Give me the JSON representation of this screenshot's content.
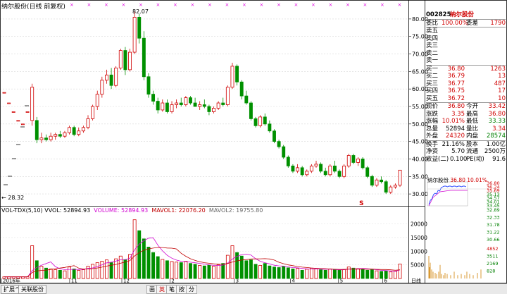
{
  "main_chart": {
    "title": "纳尔股份(日线 前复权)",
    "price_ticks": [
      "80.00",
      "75.00",
      "70.00",
      "65.00",
      "60.00",
      "55.00",
      "50.00",
      "45.00",
      "40.00",
      "35.00",
      "30.00"
    ],
    "high_label": "82.07",
    "low_label": "28.32",
    "signal_marker": "S",
    "candles": [
      {
        "o": 59.0,
        "h": 59.0,
        "l": 59.0,
        "c": 59.0
      },
      {
        "o": 56.0,
        "h": 56.0,
        "l": 56.0,
        "c": 56.0
      },
      {
        "o": 53.5,
        "h": 53.5,
        "l": 53.5,
        "c": 53.5
      },
      {
        "o": 51.0,
        "h": 51.0,
        "l": 51.0,
        "c": 51.0
      },
      {
        "o": 50.0,
        "h": 50.0,
        "l": 50.0,
        "c": 50.0
      },
      {
        "o": 53.5,
        "h": 53.5,
        "l": 53.5,
        "c": 53.5
      },
      {
        "o": 51.0,
        "h": 61.5,
        "l": 49.5,
        "c": 60.5
      },
      {
        "o": 51.0,
        "h": 52.0,
        "l": 44.5,
        "c": 45.5
      },
      {
        "o": 45.5,
        "h": 47.5,
        "l": 44.5,
        "c": 46.0
      },
      {
        "o": 46.0,
        "h": 47.0,
        "l": 45.0,
        "c": 45.5
      },
      {
        "o": 45.5,
        "h": 47.5,
        "l": 45.0,
        "c": 46.5
      },
      {
        "o": 46.5,
        "h": 47.5,
        "l": 45.5,
        "c": 47.0
      },
      {
        "o": 47.0,
        "h": 48.0,
        "l": 46.0,
        "c": 46.5
      },
      {
        "o": 46.5,
        "h": 48.0,
        "l": 46.0,
        "c": 47.5
      },
      {
        "o": 47.5,
        "h": 49.5,
        "l": 47.0,
        "c": 49.0
      },
      {
        "o": 49.0,
        "h": 49.5,
        "l": 46.5,
        "c": 47.0
      },
      {
        "o": 47.0,
        "h": 49.0,
        "l": 46.5,
        "c": 48.0
      },
      {
        "o": 48.0,
        "h": 49.5,
        "l": 47.5,
        "c": 49.0
      },
      {
        "o": 49.0,
        "h": 52.5,
        "l": 48.5,
        "c": 51.5
      },
      {
        "o": 51.5,
        "h": 55.5,
        "l": 51.0,
        "c": 55.0
      },
      {
        "o": 55.0,
        "h": 59.5,
        "l": 54.0,
        "c": 58.5
      },
      {
        "o": 58.5,
        "h": 63.5,
        "l": 57.5,
        "c": 62.5
      },
      {
        "o": 62.5,
        "h": 65.5,
        "l": 61.5,
        "c": 64.0
      },
      {
        "o": 64.0,
        "h": 66.0,
        "l": 60.0,
        "c": 61.0
      },
      {
        "o": 61.0,
        "h": 66.5,
        "l": 60.5,
        "c": 66.0
      },
      {
        "o": 66.0,
        "h": 71.5,
        "l": 65.5,
        "c": 71.0
      },
      {
        "o": 71.0,
        "h": 72.0,
        "l": 64.0,
        "c": 65.5
      },
      {
        "o": 65.5,
        "h": 71.5,
        "l": 65.0,
        "c": 70.5
      },
      {
        "o": 70.5,
        "h": 82.07,
        "l": 70.0,
        "c": 80.5
      },
      {
        "o": 80.5,
        "h": 81.5,
        "l": 73.0,
        "c": 74.5
      },
      {
        "o": 74.5,
        "h": 76.5,
        "l": 62.5,
        "c": 63.5
      },
      {
        "o": 63.5,
        "h": 64.5,
        "l": 57.5,
        "c": 58.5
      },
      {
        "o": 58.5,
        "h": 59.5,
        "l": 55.5,
        "c": 56.5
      },
      {
        "o": 56.5,
        "h": 57.5,
        "l": 53.0,
        "c": 54.0
      },
      {
        "o": 54.0,
        "h": 57.0,
        "l": 53.5,
        "c": 56.0
      },
      {
        "o": 56.0,
        "h": 57.0,
        "l": 53.0,
        "c": 53.5
      },
      {
        "o": 53.5,
        "h": 56.5,
        "l": 53.0,
        "c": 55.5
      },
      {
        "o": 55.5,
        "h": 57.0,
        "l": 54.5,
        "c": 56.0
      },
      {
        "o": 56.0,
        "h": 57.5,
        "l": 55.0,
        "c": 55.5
      },
      {
        "o": 55.5,
        "h": 58.0,
        "l": 55.0,
        "c": 57.5
      },
      {
        "o": 57.5,
        "h": 58.0,
        "l": 55.5,
        "c": 56.0
      },
      {
        "o": 56.0,
        "h": 57.5,
        "l": 55.0,
        "c": 55.0
      },
      {
        "o": 55.0,
        "h": 56.5,
        "l": 54.0,
        "c": 55.5
      },
      {
        "o": 55.5,
        "h": 57.0,
        "l": 54.5,
        "c": 55.0
      },
      {
        "o": 55.0,
        "h": 55.5,
        "l": 52.5,
        "c": 53.5
      },
      {
        "o": 53.5,
        "h": 55.0,
        "l": 53.0,
        "c": 54.5
      },
      {
        "o": 54.5,
        "h": 56.5,
        "l": 54.0,
        "c": 56.0
      },
      {
        "o": 56.0,
        "h": 57.5,
        "l": 55.0,
        "c": 55.5
      },
      {
        "o": 55.5,
        "h": 61.0,
        "l": 55.0,
        "c": 60.5
      },
      {
        "o": 60.5,
        "h": 67.5,
        "l": 60.0,
        "c": 66.5
      },
      {
        "o": 66.5,
        "h": 67.0,
        "l": 61.0,
        "c": 62.0
      },
      {
        "o": 62.0,
        "h": 62.5,
        "l": 57.0,
        "c": 58.0
      },
      {
        "o": 58.0,
        "h": 59.5,
        "l": 55.5,
        "c": 56.0
      },
      {
        "o": 56.0,
        "h": 56.5,
        "l": 51.0,
        "c": 51.5
      },
      {
        "o": 51.5,
        "h": 52.0,
        "l": 49.0,
        "c": 49.5
      },
      {
        "o": 49.5,
        "h": 52.5,
        "l": 49.0,
        "c": 52.0
      },
      {
        "o": 52.0,
        "h": 53.0,
        "l": 49.5,
        "c": 50.0
      },
      {
        "o": 50.0,
        "h": 51.0,
        "l": 47.5,
        "c": 48.0
      },
      {
        "o": 48.0,
        "h": 48.5,
        "l": 44.5,
        "c": 45.0
      },
      {
        "o": 45.0,
        "h": 45.5,
        "l": 43.0,
        "c": 43.5
      },
      {
        "o": 43.5,
        "h": 44.0,
        "l": 40.0,
        "c": 40.5
      },
      {
        "o": 40.5,
        "h": 41.0,
        "l": 37.5,
        "c": 38.0
      },
      {
        "o": 38.0,
        "h": 38.5,
        "l": 36.0,
        "c": 36.5
      },
      {
        "o": 36.5,
        "h": 38.5,
        "l": 36.0,
        "c": 37.5
      },
      {
        "o": 37.5,
        "h": 38.0,
        "l": 35.0,
        "c": 35.5
      },
      {
        "o": 35.5,
        "h": 37.0,
        "l": 35.0,
        "c": 36.5
      },
      {
        "o": 36.5,
        "h": 38.5,
        "l": 36.0,
        "c": 38.0
      },
      {
        "o": 38.0,
        "h": 39.5,
        "l": 37.5,
        "c": 38.5
      },
      {
        "o": 38.5,
        "h": 39.0,
        "l": 36.0,
        "c": 36.5
      },
      {
        "o": 36.5,
        "h": 37.5,
        "l": 35.0,
        "c": 35.5
      },
      {
        "o": 35.5,
        "h": 38.5,
        "l": 35.0,
        "c": 38.0
      },
      {
        "o": 38.0,
        "h": 39.5,
        "l": 36.0,
        "c": 36.5
      },
      {
        "o": 36.5,
        "h": 37.0,
        "l": 34.5,
        "c": 35.0
      },
      {
        "o": 35.0,
        "h": 38.5,
        "l": 34.5,
        "c": 38.0
      },
      {
        "o": 38.0,
        "h": 41.5,
        "l": 37.5,
        "c": 41.0
      },
      {
        "o": 41.0,
        "h": 41.5,
        "l": 38.5,
        "c": 39.0
      },
      {
        "o": 39.0,
        "h": 40.5,
        "l": 38.0,
        "c": 40.0
      },
      {
        "o": 40.0,
        "h": 40.5,
        "l": 37.0,
        "c": 37.5
      },
      {
        "o": 37.5,
        "h": 38.0,
        "l": 34.5,
        "c": 35.0
      },
      {
        "o": 35.0,
        "h": 35.5,
        "l": 32.0,
        "c": 32.5
      },
      {
        "o": 32.5,
        "h": 34.5,
        "l": 32.0,
        "c": 34.0
      },
      {
        "o": 34.0,
        "h": 35.0,
        "l": 33.0,
        "c": 33.5
      },
      {
        "o": 33.5,
        "h": 34.0,
        "l": 30.0,
        "c": 30.5
      },
      {
        "o": 30.5,
        "h": 32.5,
        "l": 30.0,
        "c": 32.0
      },
      {
        "o": 32.0,
        "h": 33.0,
        "l": 31.5,
        "c": 32.5
      },
      {
        "o": 32.5,
        "h": 36.8,
        "l": 32.0,
        "c": 36.8
      }
    ]
  },
  "volume_chart": {
    "title_parts": [
      {
        "text": "VOL-TDX(5,10) VVOL: 52894.93",
        "color": "#000000"
      },
      {
        "text": "VOLUME: 52894.93",
        "color": "#d000d0"
      },
      {
        "text": "MAVOL1: 22076.20",
        "color": "#c00000"
      },
      {
        "text": "MAVOL2: 19755.80",
        "color": "#666666"
      }
    ],
    "ticks": [
      "20000",
      "15000",
      "10000",
      "5000"
    ],
    "volumes": [
      600,
      600,
      600,
      600,
      600,
      600,
      12000,
      6500,
      4500,
      3800,
      3500,
      3200,
      3000,
      2800,
      4200,
      3500,
      3000,
      3200,
      4500,
      5200,
      5800,
      6300,
      6800,
      5800,
      7200,
      8200,
      6800,
      8800,
      21500,
      17500,
      14500,
      11500,
      9500,
      8000,
      7000,
      6500,
      6200,
      6000,
      5800,
      6300,
      5500,
      5200,
      4800,
      4600,
      4900,
      4500,
      5000,
      5500,
      8500,
      12000,
      9500,
      8200,
      6500,
      6800,
      5200,
      4800,
      5500,
      4600,
      4200,
      4000,
      4400,
      3900,
      3500,
      3700,
      3000,
      3400,
      3800,
      3600,
      3200,
      3000,
      3500,
      3200,
      3000,
      3300,
      4200,
      3800,
      3600,
      3400,
      3000,
      3200,
      2800,
      2600,
      2800,
      2400,
      2600,
      5300
    ]
  },
  "xaxis": {
    "labels": [
      "2016年",
      "11",
      "12",
      "2",
      "3",
      "4",
      "5",
      "6"
    ],
    "right_label": "日线"
  },
  "side_ticks": {
    "main": [
      "36.80",
      "36.24",
      "35.69",
      "35.13",
      "34.57",
      "34.01",
      "33.45"
    ],
    "volume": [
      "32.89",
      "32.33",
      "31.78",
      "31.22",
      "30.66"
    ],
    "sub": [
      "4852",
      "3511",
      "2169",
      "828"
    ]
  },
  "panel": {
    "code": "002825",
    "name": "纳尔股份",
    "weibi_label": "委比",
    "weibi_value": "100.00%",
    "weicha_label": "委差",
    "weicha_value": "1790",
    "sell": [
      {
        "label": "卖五",
        "price": "",
        "vol": ""
      },
      {
        "label": "卖四",
        "price": "",
        "vol": ""
      },
      {
        "label": "卖三",
        "price": "",
        "vol": ""
      },
      {
        "label": "卖二",
        "price": "",
        "vol": ""
      },
      {
        "label": "卖一",
        "price": "",
        "vol": ""
      }
    ],
    "buy": [
      {
        "label": "买一",
        "price": "36.80",
        "vol": "1263"
      },
      {
        "label": "买二",
        "price": "36.79",
        "vol": "13"
      },
      {
        "label": "买三",
        "price": "36.77",
        "vol": "487"
      },
      {
        "label": "买四",
        "price": "36.75",
        "vol": "17"
      },
      {
        "label": "买五",
        "price": "36.72",
        "vol": "10"
      }
    ],
    "stats": [
      {
        "l1": "现价",
        "v1": "36.80",
        "l2": "今开",
        "v2": "33.42",
        "c1": "red",
        "c2": "red"
      },
      {
        "l1": "涨跌",
        "v1": "3.35",
        "l2": "最高",
        "v2": "36.80",
        "c1": "red",
        "c2": "red"
      },
      {
        "l1": "涨幅",
        "v1": "10.01%",
        "l2": "最低",
        "v2": "33.33",
        "c1": "red",
        "c2": "green"
      },
      {
        "l1": "总量",
        "v1": "52894",
        "l2": "量比",
        "v2": "3.34",
        "c1": "black",
        "c2": "red"
      },
      {
        "l1": "外盘",
        "v1": "24320",
        "l2": "内盘",
        "v2": "28574",
        "c1": "red",
        "c2": "green"
      }
    ],
    "stats2": [
      {
        "l1": "换手",
        "v1": "21.16%",
        "l2": "股本",
        "v2": "1.00亿"
      },
      {
        "l1": "净资",
        "v1": "5.70",
        "l2": "流通",
        "v2": "2500万"
      },
      {
        "l1": "收益(二)",
        "v1": "0.100",
        "l2": "PE(动)",
        "v2": "91.6"
      }
    ],
    "mini_title": "纳尔股份",
    "mini_price": "36.80",
    "mini_pct": "10.01%"
  },
  "bottom_bar": {
    "tabs": [
      "扩展^",
      "关联股份"
    ],
    "icons": [
      "画",
      "英",
      "笔",
      "按",
      "分"
    ]
  },
  "colors": {
    "up": "#d00000",
    "down": "#009000",
    "ma1": "#c00000",
    "ma2": "#d000d0"
  }
}
